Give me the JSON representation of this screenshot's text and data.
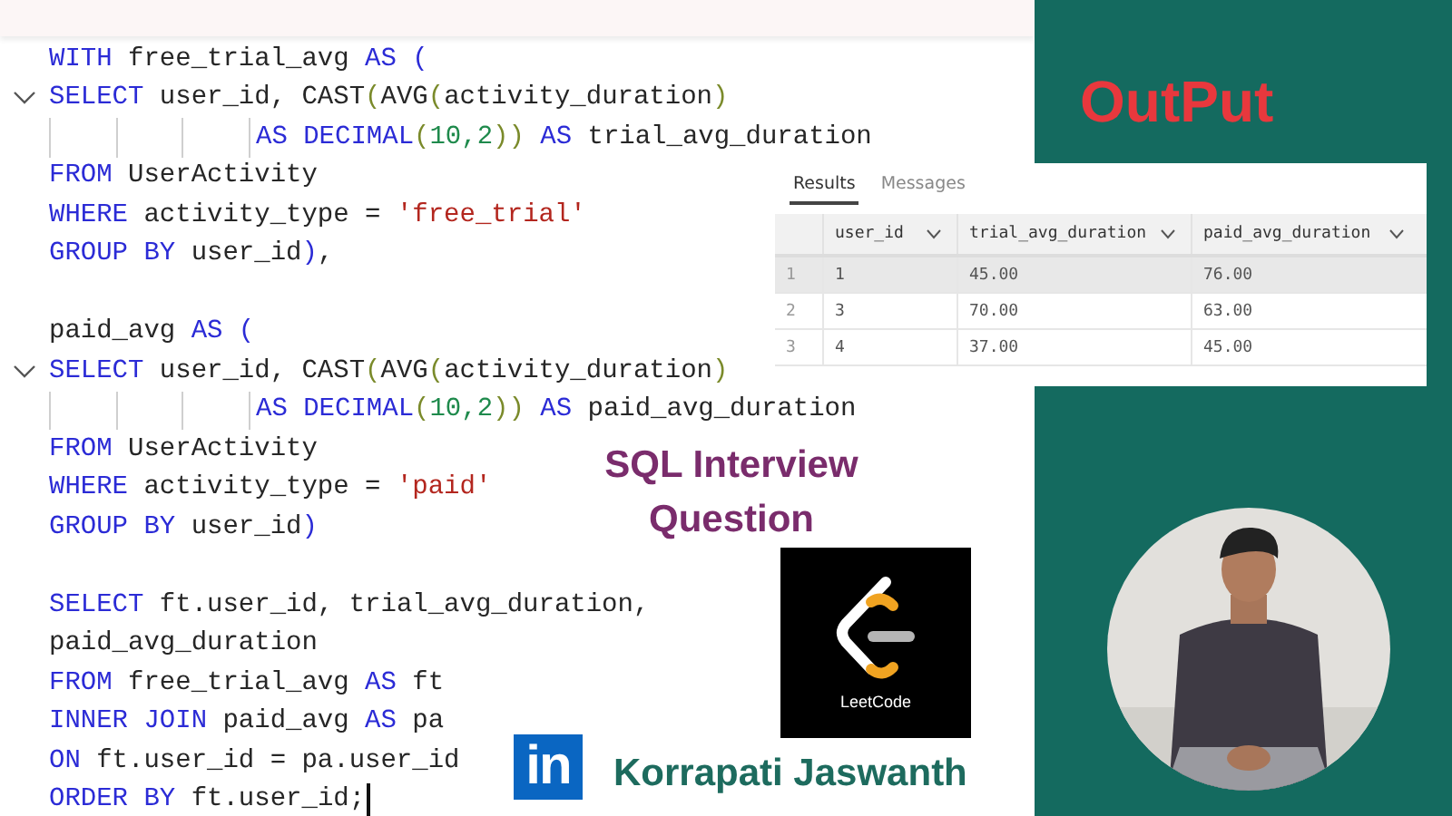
{
  "editor": {
    "lines": [
      {
        "kind": "code",
        "tokens": [
          {
            "kind": "keyword",
            "text": "WITH"
          },
          {
            "kind": "plain",
            "text": " free_trial_avg "
          },
          {
            "kind": "keyword",
            "text": "AS ("
          }
        ]
      },
      {
        "kind": "fold",
        "tokens": [
          {
            "kind": "keyword",
            "text": "SELECT"
          },
          {
            "kind": "plain",
            "text": " user_id, CAST"
          },
          {
            "kind": "bracket",
            "text": "("
          },
          {
            "kind": "plain",
            "text": "AVG"
          },
          {
            "kind": "bracket",
            "text": "("
          },
          {
            "kind": "plain",
            "text": "activity_duration"
          },
          {
            "kind": "bracket",
            "text": ")"
          }
        ]
      },
      {
        "kind": "continuation",
        "tokens": [
          {
            "kind": "keyword",
            "text": "AS DECIMAL"
          },
          {
            "kind": "bracket",
            "text": "("
          },
          {
            "kind": "number",
            "text": "10,2"
          },
          {
            "kind": "bracket",
            "text": "))"
          },
          {
            "kind": "keyword",
            "text": " AS"
          },
          {
            "kind": "plain",
            "text": " trial_avg_duration"
          }
        ]
      },
      {
        "kind": "code",
        "tokens": [
          {
            "kind": "keyword",
            "text": "FROM"
          },
          {
            "kind": "plain",
            "text": " UserActivity"
          }
        ]
      },
      {
        "kind": "code",
        "tokens": [
          {
            "kind": "keyword",
            "text": "WHERE"
          },
          {
            "kind": "plain",
            "text": " activity_type = "
          },
          {
            "kind": "string",
            "text": "'free_trial'"
          }
        ]
      },
      {
        "kind": "code",
        "tokens": [
          {
            "kind": "keyword",
            "text": "GROUP BY"
          },
          {
            "kind": "plain",
            "text": " user_id"
          },
          {
            "kind": "keyword",
            "text": ")"
          },
          {
            "kind": "plain",
            "text": ","
          }
        ]
      },
      {
        "kind": "blank"
      },
      {
        "kind": "code",
        "tokens": [
          {
            "kind": "plain",
            "text": "paid_avg "
          },
          {
            "kind": "keyword",
            "text": "AS ("
          }
        ]
      },
      {
        "kind": "fold",
        "tokens": [
          {
            "kind": "keyword",
            "text": "SELECT"
          },
          {
            "kind": "plain",
            "text": " user_id, CAST"
          },
          {
            "kind": "bracket",
            "text": "("
          },
          {
            "kind": "plain",
            "text": "AVG"
          },
          {
            "kind": "bracket",
            "text": "("
          },
          {
            "kind": "plain",
            "text": "activity_duration"
          },
          {
            "kind": "bracket",
            "text": ")"
          }
        ]
      },
      {
        "kind": "continuation",
        "tokens": [
          {
            "kind": "keyword",
            "text": "AS DECIMAL"
          },
          {
            "kind": "bracket",
            "text": "("
          },
          {
            "kind": "number",
            "text": "10,2"
          },
          {
            "kind": "bracket",
            "text": "))"
          },
          {
            "kind": "keyword",
            "text": " AS"
          },
          {
            "kind": "plain",
            "text": " paid_avg_duration"
          }
        ]
      },
      {
        "kind": "code",
        "tokens": [
          {
            "kind": "keyword",
            "text": "FROM"
          },
          {
            "kind": "plain",
            "text": " UserActivity"
          }
        ]
      },
      {
        "kind": "code",
        "tokens": [
          {
            "kind": "keyword",
            "text": "WHERE"
          },
          {
            "kind": "plain",
            "text": " activity_type = "
          },
          {
            "kind": "string",
            "text": "'paid'"
          }
        ]
      },
      {
        "kind": "code",
        "tokens": [
          {
            "kind": "keyword",
            "text": "GROUP BY"
          },
          {
            "kind": "plain",
            "text": " user_id"
          },
          {
            "kind": "keyword",
            "text": ")"
          }
        ]
      },
      {
        "kind": "blank"
      },
      {
        "kind": "code",
        "tokens": [
          {
            "kind": "keyword",
            "text": "SELECT"
          },
          {
            "kind": "plain",
            "text": " ft.user_id, trial_avg_duration,"
          }
        ]
      },
      {
        "kind": "code",
        "tokens": [
          {
            "kind": "plain",
            "text": "paid_avg_duration"
          }
        ]
      },
      {
        "kind": "code",
        "tokens": [
          {
            "kind": "keyword",
            "text": "FROM"
          },
          {
            "kind": "plain",
            "text": " free_trial_avg "
          },
          {
            "kind": "keyword",
            "text": "AS"
          },
          {
            "kind": "plain",
            "text": " ft"
          }
        ]
      },
      {
        "kind": "code",
        "tokens": [
          {
            "kind": "keyword",
            "text": "INNER JOIN"
          },
          {
            "kind": "plain",
            "text": " paid_avg "
          },
          {
            "kind": "keyword",
            "text": "AS"
          },
          {
            "kind": "plain",
            "text": " pa"
          }
        ]
      },
      {
        "kind": "code",
        "tokens": [
          {
            "kind": "keyword",
            "text": "ON"
          },
          {
            "kind": "plain",
            "text": " ft.user_id = pa.user_id"
          }
        ]
      },
      {
        "kind": "cursor",
        "tokens": [
          {
            "kind": "keyword",
            "text": "ORDER BY"
          },
          {
            "kind": "plain",
            "text": " ft.user_id;"
          }
        ]
      }
    ]
  },
  "output_title": "OutPut",
  "results": {
    "tabs": [
      {
        "label": "Results",
        "selected": true
      },
      {
        "label": "Messages",
        "selected": false
      }
    ],
    "columns": [
      "user_id",
      "trial_avg_duration",
      "paid_avg_duration"
    ],
    "rows": [
      {
        "number": "1",
        "cells": [
          "1",
          "45.00",
          "76.00"
        ],
        "selected": true
      },
      {
        "number": "2",
        "cells": [
          "3",
          "70.00",
          "63.00"
        ],
        "selected": false
      },
      {
        "number": "3",
        "cells": [
          "4",
          "37.00",
          "45.00"
        ],
        "selected": false
      }
    ]
  },
  "headline": [
    "SQL Interview",
    "Question"
  ],
  "logo": {
    "caption": "LeetCode"
  },
  "author": {
    "badge": "in",
    "name": "Korrapati Jaswanth"
  },
  "photo": {
    "kind": "picture"
  }
}
